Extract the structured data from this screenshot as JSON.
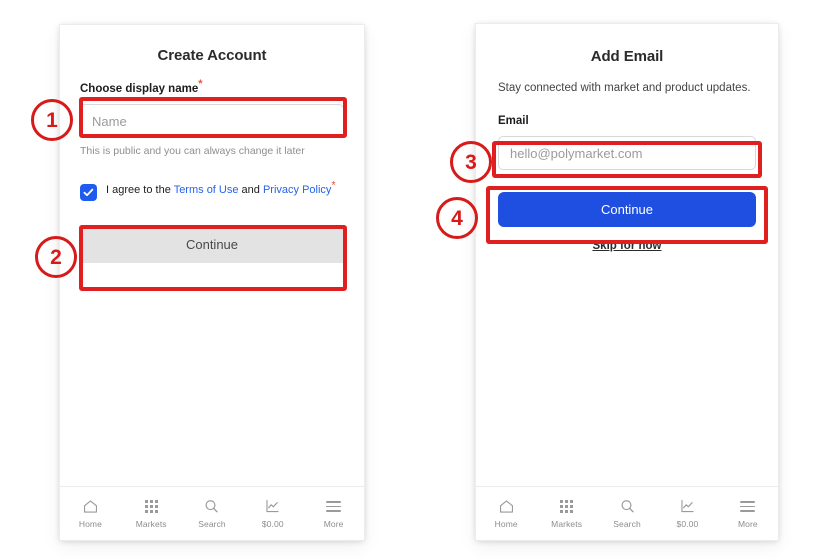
{
  "screens": [
    {
      "id": "create-account",
      "title": "Create Account",
      "name_label": "Choose display name",
      "required_marker": "*",
      "name_placeholder": "Name",
      "name_helper": "This is public and you can always change it later",
      "agree_prefix": "I agree to the ",
      "agree_terms": "Terms of Use",
      "agree_middle": " and ",
      "agree_privacy": "Privacy Policy",
      "continue_label": "Continue",
      "continue_state": "disabled"
    },
    {
      "id": "add-email",
      "title": "Add Email",
      "subtitle": "Stay connected with market and product updates.",
      "email_label": "Email",
      "email_placeholder": "hello@polymarket.com",
      "continue_label": "Continue",
      "continue_state": "enabled",
      "skip_label": "Skip for now"
    }
  ],
  "bottom_nav": {
    "items": [
      {
        "icon": "home-icon",
        "label": "Home"
      },
      {
        "icon": "grid-icon",
        "label": "Markets"
      },
      {
        "icon": "search-icon",
        "label": "Search"
      },
      {
        "icon": "chart-icon",
        "label": "$0.00"
      },
      {
        "icon": "menu-icon",
        "label": "More"
      }
    ]
  },
  "annotations": {
    "markers": [
      {
        "number": "1",
        "target": "display-name-input"
      },
      {
        "number": "2",
        "target": "create-account-continue-button"
      },
      {
        "number": "3",
        "target": "email-input"
      },
      {
        "number": "4",
        "target": "add-email-continue-button"
      }
    ],
    "color": "#e02020"
  }
}
